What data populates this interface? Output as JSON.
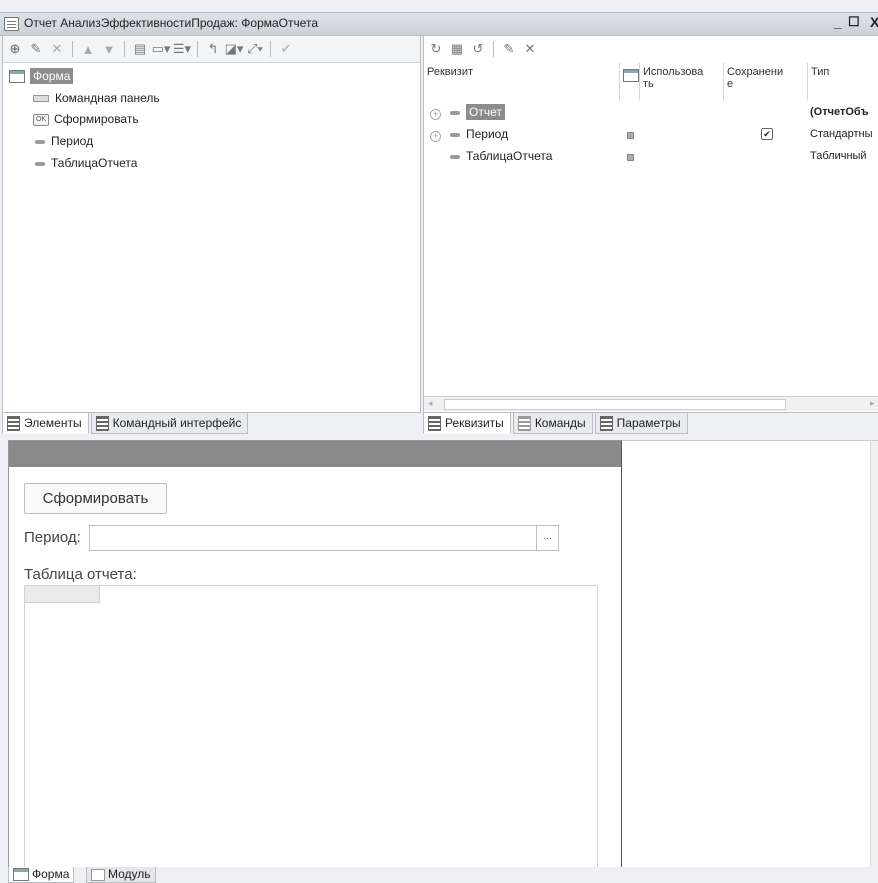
{
  "window": {
    "title": "Отчет АнализЭффективностиПродаж: ФормаОтчета",
    "minimize": "_",
    "maximize": "☐",
    "close": "X"
  },
  "elements_panel": {
    "tree": [
      {
        "label": "Форма",
        "icon": "form-icon",
        "selected": true
      },
      {
        "label": "Командная панель",
        "icon": "command-bar-icon"
      },
      {
        "label": "Сформировать",
        "icon": "button-ok-icon",
        "icon_text": "OK"
      },
      {
        "label": "Период",
        "icon": "field-icon"
      },
      {
        "label": "ТаблицаОтчета",
        "icon": "field-icon"
      }
    ],
    "tabs": [
      {
        "label": "Элементы",
        "active": true
      },
      {
        "label": "Командный интерфейс",
        "active": false
      }
    ]
  },
  "attributes_panel": {
    "columns": {
      "attribute": "Реквизит",
      "use_line1": "Использова",
      "use_line2": "ть",
      "saved_line1": "Сохранени",
      "saved_line2": "е",
      "type": "Тип"
    },
    "rows": [
      {
        "name": "Отчет",
        "expandable": true,
        "selected": true,
        "use": false,
        "saved": false,
        "type": "(ОтчетОбъ"
      },
      {
        "name": "Период",
        "expandable": true,
        "selected": false,
        "use": true,
        "saved": true,
        "type": "Стандартны"
      },
      {
        "name": "ТаблицаОтчета",
        "expandable": false,
        "selected": false,
        "use": true,
        "saved": false,
        "type": "Табличный"
      }
    ],
    "tabs": [
      {
        "label": "Реквизиты",
        "active": true
      },
      {
        "label": "Команды",
        "active": false
      },
      {
        "label": "Параметры",
        "active": false
      }
    ]
  },
  "preview": {
    "button_label": "Сформировать",
    "period_label": "Период:",
    "period_value": "",
    "period_select": "...",
    "table_label": "Таблица отчета:"
  },
  "bottom_tabs": [
    {
      "label": "Форма",
      "active": true
    },
    {
      "label": "Модуль",
      "active": false
    }
  ]
}
